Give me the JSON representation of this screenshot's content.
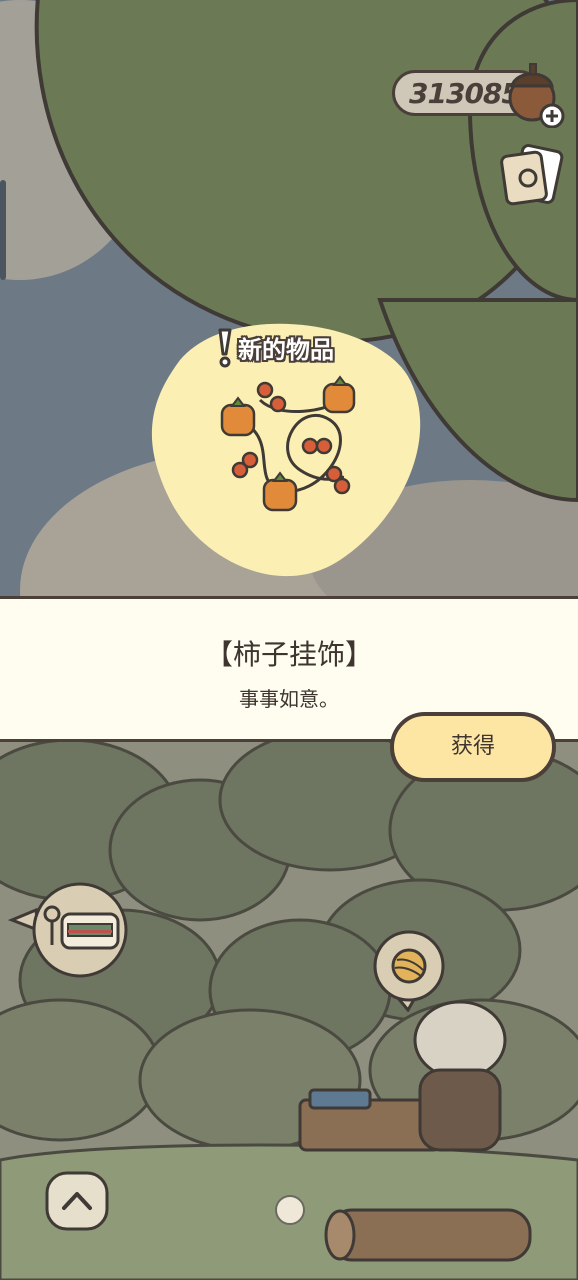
{
  "hud": {
    "currency_value": "313085",
    "currency_icon": "acorn-plus-icon",
    "card_icon": "postcard-icon"
  },
  "new_item": {
    "label": "新的物品",
    "image": "persimmon-garland"
  },
  "panel": {
    "item_name": "【柿子挂饰】",
    "item_description": "事事如意。",
    "obtain_label": "获得"
  },
  "world": {
    "station_icon": "train-station-icon",
    "yarn_icon": "yarn-ball-icon",
    "up_icon": "chevron-up-icon"
  },
  "colors": {
    "outline": "#4a3f39",
    "leaf_green": "#6b7a55",
    "glow": "#fcefb4",
    "panel_bg": "#fffdf0",
    "button_bg": "#fde6a3"
  }
}
